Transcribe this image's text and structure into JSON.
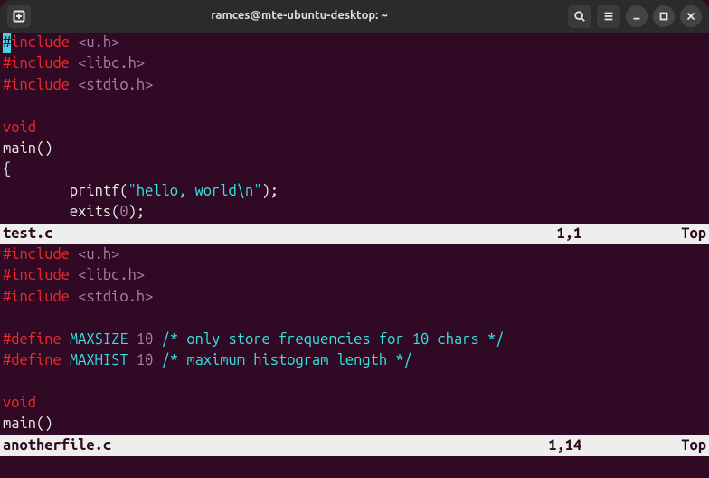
{
  "titlebar": {
    "title": "ramces@mte-ubuntu-desktop: ~"
  },
  "pane1": {
    "lines": {
      "l0_inc": "include",
      "l0_hdr": "<u.h>",
      "l1_inc": "#include",
      "l1_hdr": "<libc.h>",
      "l2_inc": "#include",
      "l2_hdr": "<stdio.h>",
      "void": "void",
      "main": "main()",
      "brace_open": "{",
      "printf_indent": "        printf(",
      "printf_str": "\"hello, world\\n\"",
      "printf_end": ");",
      "exits_indent": "        exits(",
      "exits_num": "0",
      "exits_end": ");"
    },
    "status": {
      "filename": "test.c",
      "position": "1,1",
      "scroll": "Top"
    }
  },
  "pane2": {
    "lines": {
      "l0_inc": "#include",
      "l0_hdr": "<u.h>",
      "l1_inc": "#include",
      "l1_hdr": "<libc.h>",
      "l2_inc": "#include",
      "l2_hdr": "<stdio.h>",
      "d1_def": "#define",
      "d1_name": "MAXSIZE",
      "d1_val": "10",
      "d1_cmt": "/* only store frequencies for 10 chars */",
      "d2_def": "#define",
      "d2_name": "MAXHIST",
      "d2_val": "10",
      "d2_cmt": "/* maximum histogram length */",
      "void": "void",
      "main": "main()"
    },
    "status": {
      "filename": "anotherfile.c",
      "position": "1,14",
      "scroll": "Top"
    }
  },
  "cursor_char": "#"
}
